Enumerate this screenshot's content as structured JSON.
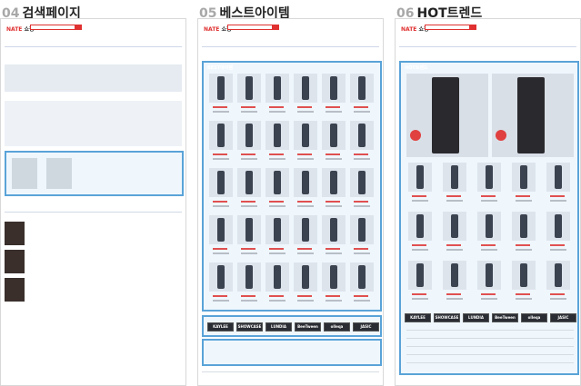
{
  "panels": [
    {
      "number": "04",
      "title": "검색페이지"
    },
    {
      "number": "05",
      "title": "베스트아이템"
    },
    {
      "number": "06",
      "title": "HOT트렌드"
    }
  ],
  "brand": {
    "logo": "NATE",
    "shop": "쇼핑"
  },
  "best_section_title": "BEST아이템",
  "hot_section_title": "HOT트렌드",
  "brands": [
    "KAYLEE",
    "SHOWCASE",
    "LUNDIA",
    "BeeTween",
    "olleqa",
    "JASIC"
  ],
  "colors": {
    "highlight": "#5aa3d8",
    "accent": "#e03030"
  }
}
